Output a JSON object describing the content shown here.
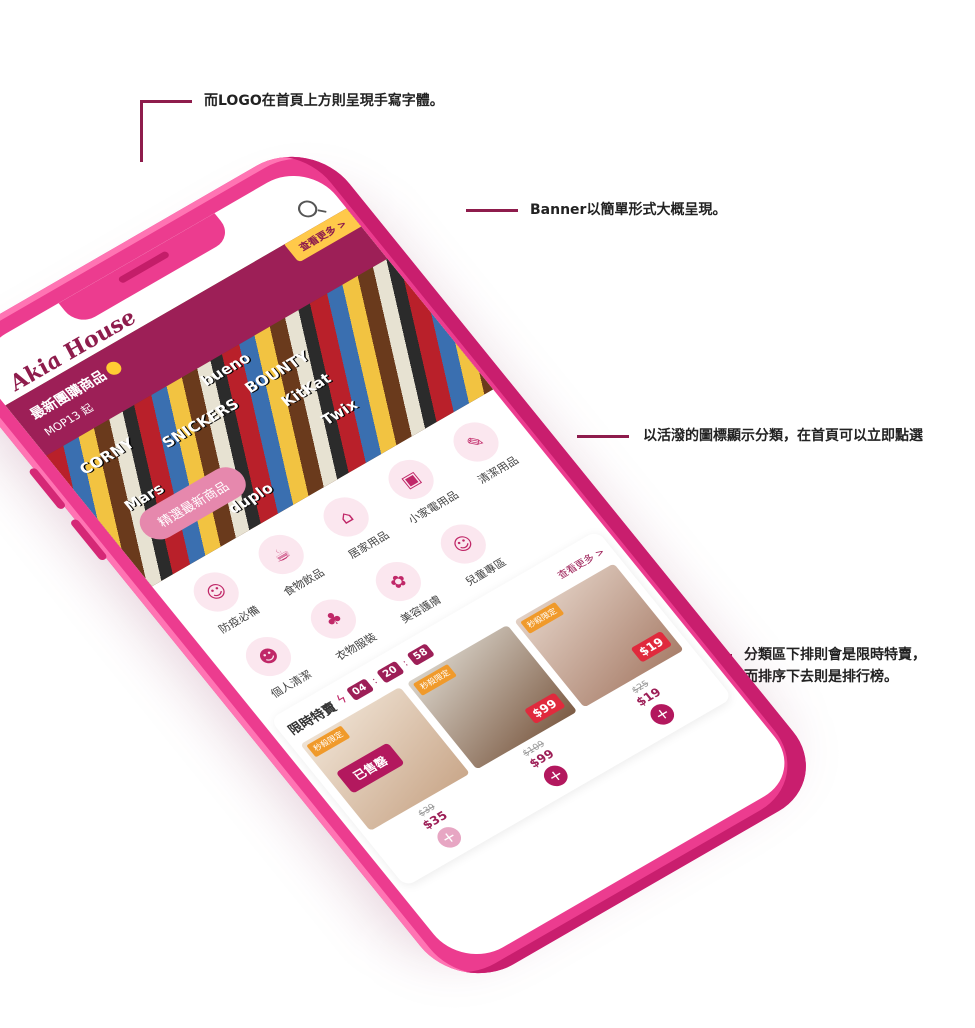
{
  "annotations": {
    "logo_note": "而LOGO在首頁上方則呈現手寫字體。",
    "banner_note": "Banner以簡單形式大概呈現。",
    "category_note": "以活潑的圖標顯示分類，在首頁可以立即點選",
    "flash_note_line1": "分類區下排則會是限時特賣，",
    "flash_note_line2": "而排序下去則是排行榜。"
  },
  "app": {
    "logo": "Akia House",
    "search_icon": "search-icon"
  },
  "banner": {
    "title": "最新團購商品",
    "subtitle": "MOP13 起",
    "more_label": "查看更多 >",
    "cta_label": "精選最新商品",
    "brand_labels": [
      "CORNY",
      "SNICKERS",
      "bueno",
      "BOUNTY",
      "KitKat",
      "Twix",
      "duplo",
      "Mars"
    ]
  },
  "categories": [
    {
      "label": "防疫必備",
      "icon": "mask-icon",
      "glyph": "☺"
    },
    {
      "label": "食物飲品",
      "icon": "food-icon",
      "glyph": "☕"
    },
    {
      "label": "居家用品",
      "icon": "home-icon",
      "glyph": "⌂"
    },
    {
      "label": "小家電用品",
      "icon": "appliance-icon",
      "glyph": "▣"
    },
    {
      "label": "清潔用品",
      "icon": "cleaning-icon",
      "glyph": "✎"
    },
    {
      "label": "個人清潔",
      "icon": "person-icon",
      "glyph": "☻"
    },
    {
      "label": "衣物服裝",
      "icon": "dress-icon",
      "glyph": "♣"
    },
    {
      "label": "美容護膚",
      "icon": "beauty-icon",
      "glyph": "✿"
    },
    {
      "label": "兒童專區",
      "icon": "baby-icon",
      "glyph": "☺"
    }
  ],
  "flash_sale": {
    "title": "限時特賣",
    "bolt_icon": "lightning-icon",
    "hours": "04",
    "minutes": "20",
    "seconds": "58",
    "more_label": "查看更多 >",
    "products": [
      {
        "tag": "秒殺限定",
        "badge": "已售罄",
        "old_price": "$39",
        "price": "$35",
        "add": "+"
      },
      {
        "tag": "秒殺限定",
        "badge": "$99",
        "old_price": "$109",
        "price": "$99",
        "add": "+"
      },
      {
        "tag": "秒殺限定",
        "badge": "$19",
        "old_price": "$25",
        "price": "$19",
        "add": "+"
      }
    ]
  },
  "colors": {
    "phone": "#ec3c8f",
    "brand": "#9d1f57",
    "accent": "#ffc94a"
  }
}
